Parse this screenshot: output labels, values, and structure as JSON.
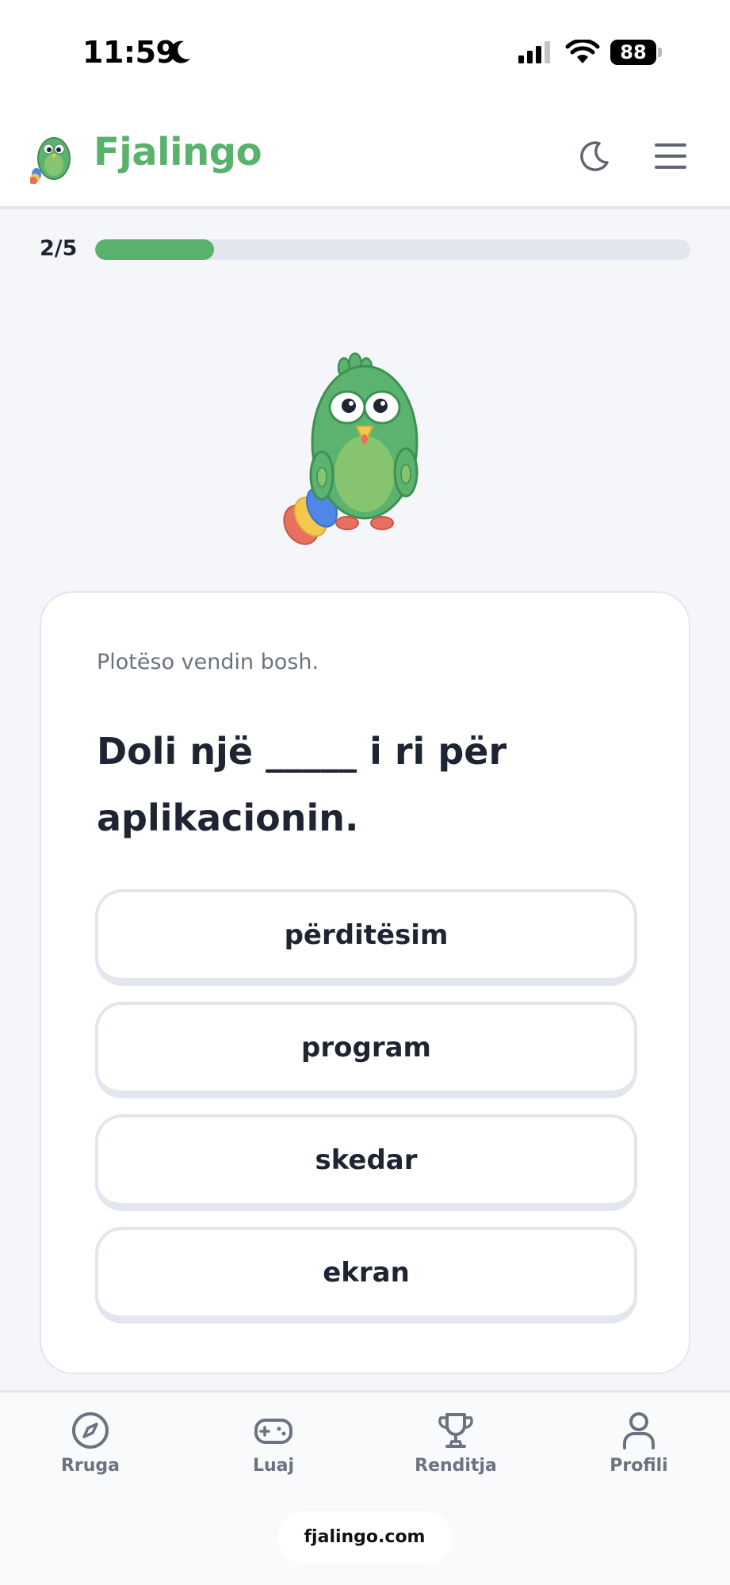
{
  "status_bar": {
    "time": "11:59",
    "battery": "88"
  },
  "header": {
    "brand": "Fjalingo",
    "theme_icon": "moon-icon",
    "menu_icon": "hamburger-menu-icon"
  },
  "progress": {
    "label": "2/5",
    "fraction": 0.2
  },
  "quiz": {
    "instruction": "Plotëso vendin bosh.",
    "question": "Doli një _____ i ri për aplikacionin.",
    "options": [
      {
        "label": "përditësim"
      },
      {
        "label": "program"
      },
      {
        "label": "skedar"
      },
      {
        "label": "ekran"
      }
    ]
  },
  "bottom_nav": {
    "items": [
      {
        "label": "Rruga",
        "icon": "compass-icon"
      },
      {
        "label": "Luaj",
        "icon": "gamepad-icon"
      },
      {
        "label": "Renditja",
        "icon": "trophy-icon"
      },
      {
        "label": "Profili",
        "icon": "user-icon"
      }
    ]
  },
  "url_bar": {
    "domain": "fjalingo.com"
  },
  "colors": {
    "brand_green": "#58b26c",
    "track_gray": "#e3e6ee",
    "text_dark": "#1f2433",
    "text_muted": "#6b7280"
  }
}
